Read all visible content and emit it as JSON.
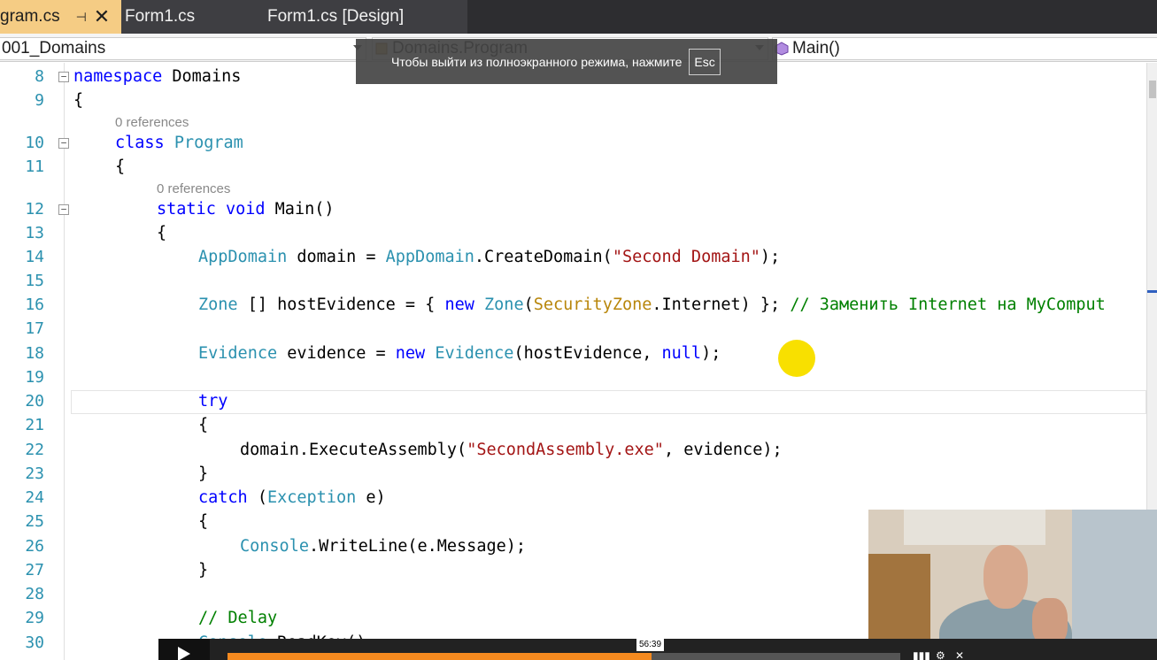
{
  "tabs": [
    {
      "label": "gram.cs",
      "pin": "⊣",
      "close": "✕"
    },
    {
      "label": "Form1.cs"
    },
    {
      "label": "Form1.cs [Design]"
    }
  ],
  "nav": {
    "project": "001_Domains",
    "type": "Domains.Program",
    "member": "Main()"
  },
  "fullscreen_tip": {
    "text": "Чтобы выйти из полноэкранного режима, нажмите",
    "key": "Esc"
  },
  "editor": {
    "codelens": "0 references",
    "lines": [
      {
        "n": "8"
      },
      {
        "n": "9"
      },
      {
        "n": "10"
      },
      {
        "n": "11"
      },
      {
        "n": "12"
      },
      {
        "n": "13"
      },
      {
        "n": "14"
      },
      {
        "n": "15"
      },
      {
        "n": "16"
      },
      {
        "n": "17"
      },
      {
        "n": "18"
      },
      {
        "n": "19"
      },
      {
        "n": "20"
      },
      {
        "n": "21"
      },
      {
        "n": "22"
      },
      {
        "n": "23"
      },
      {
        "n": "24"
      },
      {
        "n": "25"
      },
      {
        "n": "26"
      },
      {
        "n": "27"
      },
      {
        "n": "28"
      },
      {
        "n": "29"
      },
      {
        "n": "30"
      }
    ],
    "code": {
      "l8_kw": "namespace",
      "l8_name": " Domains",
      "l9": "{",
      "l10_kw": "class",
      "l10_ty": " Program",
      "l11": "{",
      "l12_kw1": "static",
      "l12_kw2": " void",
      "l12_rest": " Main()",
      "l13": "{",
      "l14_ty": "AppDomain",
      "l14_a": " domain = ",
      "l14_ty2": "AppDomain",
      "l14_b": ".CreateDomain(",
      "l14_str": "\"Second Domain\"",
      "l14_c": ");",
      "l16_ty": "Zone",
      "l16_a": " [] hostEvidence = { ",
      "l16_kw": "new",
      "l16_ty2": " Zone",
      "l16_b": "(",
      "l16_en": "SecurityZone",
      "l16_c": ".Internet) }; ",
      "l16_cm": "// Заменить Internet на MyComput",
      "l18_ty": "Evidence",
      "l18_a": " evidence = ",
      "l18_kw": "new",
      "l18_ty2": " Evidence",
      "l18_b": "(hostEvidence, ",
      "l18_kw2": "null",
      "l18_c": ");",
      "l20_kw": "try",
      "l21": "{",
      "l22_a": "domain.ExecuteAssembly(",
      "l22_str": "\"SecondAssembly.exe\"",
      "l22_b": ", evidence);",
      "l23": "}",
      "l24_kw": "catch",
      "l24_a": " (",
      "l24_ty": "Exception",
      "l24_b": " e)",
      "l25": "{",
      "l26_ty": "Console",
      "l26_a": ".WriteLine(e.Message);",
      "l27": "}",
      "l29_cm": "// Delay",
      "l30_ty": "Console",
      "l30_a": ".ReadKey();"
    }
  },
  "player": {
    "time": "56:39",
    "progress": 0.63,
    "accent": "#f58a1f"
  }
}
